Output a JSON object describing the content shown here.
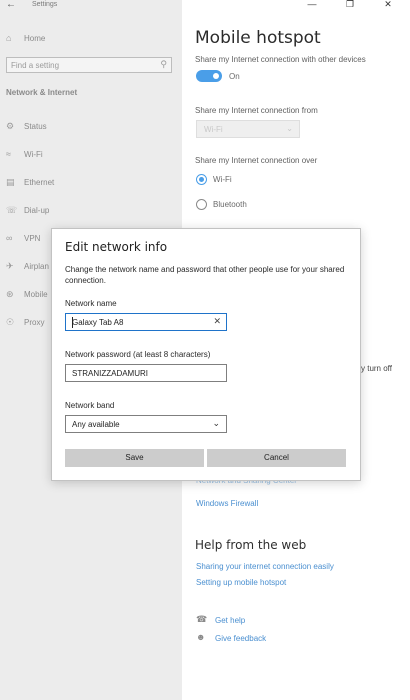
{
  "app": {
    "title": "Settings",
    "back_icon": "back-arrow-icon",
    "window_controls": [
      "minimize-icon",
      "maximize-icon",
      "close-icon"
    ]
  },
  "sidebar": {
    "home_label": "Home",
    "search_placeholder": "Find a setting",
    "section_title": "Network & Internet",
    "items": [
      {
        "label": "Status",
        "icon": "globe-status-icon"
      },
      {
        "label": "Wi-Fi",
        "icon": "wifi-icon"
      },
      {
        "label": "Ethernet",
        "icon": "ethernet-icon"
      },
      {
        "label": "Dial-up",
        "icon": "dialup-icon"
      },
      {
        "label": "VPN",
        "icon": "vpn-icon"
      },
      {
        "label": "Airplan",
        "icon": "airplane-icon"
      },
      {
        "label": "Mobile",
        "icon": "mobile-hotspot-icon"
      },
      {
        "label": "Proxy",
        "icon": "globe-proxy-icon"
      }
    ]
  },
  "main": {
    "title": "Mobile hotspot",
    "share_connection_label": "Share my Internet connection with other devices",
    "toggle_state": "On",
    "share_from_label": "Share my Internet connection from",
    "share_from_value": "Wi-Fi",
    "share_over_label": "Share my Internet connection over",
    "share_over_options": [
      {
        "label": "Wi-Fi",
        "selected": true
      },
      {
        "label": "Bluetooth",
        "selected": false
      }
    ],
    "peek_text": "y turn off",
    "related_links": [
      "Network and Sharing Center",
      "Windows Firewall"
    ],
    "help_title": "Help from the web",
    "help_links": [
      "Sharing your internet connection easily",
      "Setting up mobile hotspot"
    ],
    "get_help": "Get help",
    "give_feedback": "Give feedback"
  },
  "dialog": {
    "title": "Edit network info",
    "description": "Change the network name and password that other people use for your shared connection.",
    "name_label": "Network name",
    "name_value": "Galaxy Tab A8",
    "password_label": "Network password (at least 8 characters)",
    "password_value": "STRANIZZADAMURI",
    "band_label": "Network band",
    "band_value": "Any available",
    "save_label": "Save",
    "cancel_label": "Cancel"
  },
  "colors": {
    "accent": "#4a9ee8",
    "link": "#4a8fd0",
    "sidebar_bg": "#ececec",
    "dialog_button": "#cccccc"
  }
}
